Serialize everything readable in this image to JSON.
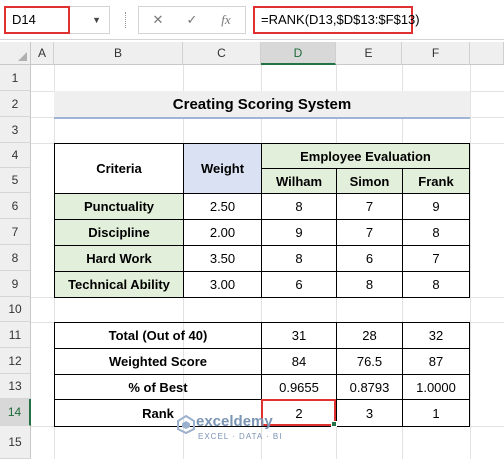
{
  "formula_bar": {
    "name_box": "D14",
    "cancel_icon": "✕",
    "enter_icon": "✓",
    "fx_label": "fx",
    "formula": "=RANK(D13,$D$13:$F$13)"
  },
  "columns": [
    "A",
    "B",
    "C",
    "D",
    "E",
    "F"
  ],
  "rows": [
    "1",
    "2",
    "3",
    "4",
    "5",
    "6",
    "7",
    "8",
    "9",
    "10",
    "11",
    "12",
    "13",
    "14",
    "15"
  ],
  "selected_cell": "D14",
  "sheet": {
    "title": "Creating Scoring System",
    "criteria_header": "Criteria",
    "weight_header": "Weight",
    "eval_header": "Employee Evaluation",
    "employees": [
      "Wilham",
      "Simon",
      "Frank"
    ],
    "criteria": [
      {
        "name": "Punctuality",
        "weight": "2.50",
        "scores": [
          "8",
          "7",
          "9"
        ]
      },
      {
        "name": "Discipline",
        "weight": "2.00",
        "scores": [
          "9",
          "7",
          "8"
        ]
      },
      {
        "name": "Hard Work",
        "weight": "3.50",
        "scores": [
          "8",
          "6",
          "7"
        ]
      },
      {
        "name": "Technical Ability",
        "weight": "3.00",
        "scores": [
          "6",
          "8",
          "8"
        ]
      }
    ],
    "summary": [
      {
        "label": "Total (Out of 40)",
        "values": [
          "31",
          "28",
          "32"
        ]
      },
      {
        "label": "Weighted Score",
        "values": [
          "84",
          "76.5",
          "87"
        ]
      },
      {
        "label": "% of Best",
        "values": [
          "0.9655",
          "0.8793",
          "1.0000"
        ]
      },
      {
        "label": "Rank",
        "values": [
          "2",
          "3",
          "1"
        ]
      }
    ]
  },
  "watermark": {
    "name": "exceldemy",
    "sub": "EXCEL · DATA · BI"
  },
  "colors": {
    "selection": "#e03131",
    "green_fill": "#e2efda",
    "blue_fill": "#d9e1f2",
    "accent": "#217346"
  }
}
